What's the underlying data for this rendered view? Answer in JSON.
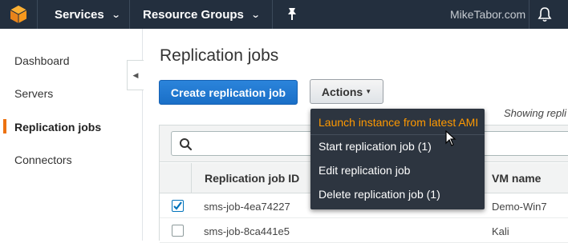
{
  "topbar": {
    "nav": [
      {
        "label": "Services"
      },
      {
        "label": "Resource Groups"
      }
    ],
    "username": "MikeTabor.com"
  },
  "sidebar": {
    "items": [
      {
        "label": "Dashboard",
        "active": false
      },
      {
        "label": "Servers",
        "active": false
      },
      {
        "label": "Replication jobs",
        "active": true
      },
      {
        "label": "Connectors",
        "active": false
      }
    ]
  },
  "main": {
    "title": "Replication jobs",
    "create_button": "Create replication job",
    "actions_button": "Actions",
    "showing_text": "Showing repli",
    "table": {
      "columns": [
        "Replication job ID",
        "VM name"
      ],
      "rows": [
        {
          "job_id": "sms-job-4ea74227",
          "vm_name": "Demo-Win7",
          "checked": true
        },
        {
          "job_id": "sms-job-8ca441e5",
          "vm_name": "Kali",
          "checked": false
        }
      ]
    }
  },
  "actions_menu": {
    "items": [
      {
        "label": "Launch instance from latest AMI",
        "highlighted": true
      },
      {
        "label": "Start replication job (1)",
        "highlighted": false
      },
      {
        "label": "Edit replication job",
        "highlighted": false
      },
      {
        "label": "Delete replication job (1)",
        "highlighted": false
      }
    ]
  },
  "colors": {
    "nav_bg": "#232f3e",
    "primary": "#1a6fc7",
    "accent": "#ec7211",
    "menu_bg": "#2d3540",
    "menu_highlight": "#ff9900"
  },
  "icons": [
    "aws-logo-icon",
    "chevron-down-icon",
    "pin-icon",
    "bell-icon",
    "chevron-left-icon",
    "search-icon",
    "checkmark-icon",
    "mouse-cursor-icon"
  ]
}
